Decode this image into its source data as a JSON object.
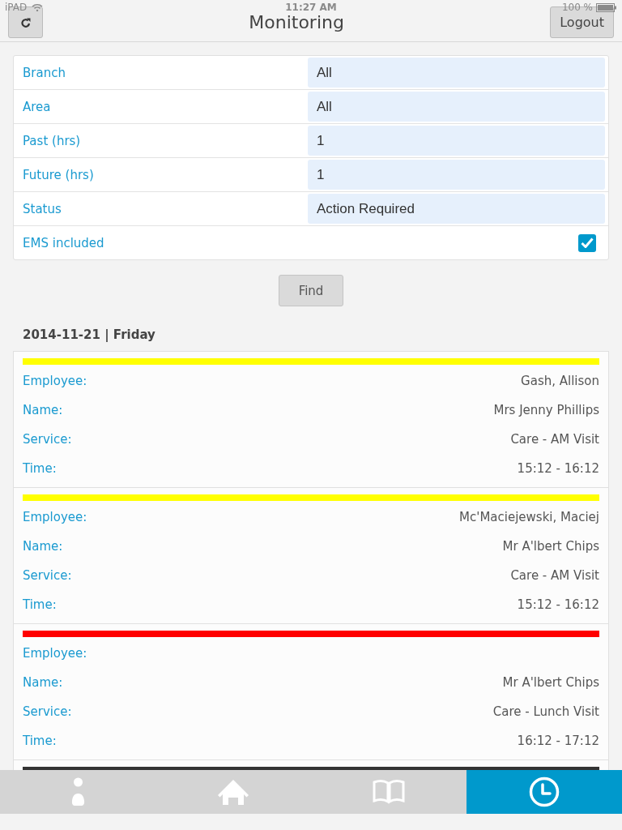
{
  "status_bar": {
    "carrier": "iPAD",
    "time": "11:27 AM",
    "battery": "100 %"
  },
  "header": {
    "title": "Monitoring",
    "logout": "Logout"
  },
  "filters": [
    {
      "kind": "select",
      "label": "Branch",
      "value": "All"
    },
    {
      "kind": "select",
      "label": "Area",
      "value": "All"
    },
    {
      "kind": "number",
      "label": "Past (hrs)",
      "value": "1"
    },
    {
      "kind": "number",
      "label": "Future (hrs)",
      "value": "1"
    },
    {
      "kind": "select",
      "label": "Status",
      "value": "Action Required"
    },
    {
      "kind": "checkbox",
      "label": "EMS included",
      "checked": true
    }
  ],
  "find_button": "Find",
  "date_heading": "2014-11-21 | Friday",
  "visits": [
    {
      "color": "#ffff00",
      "fields": [
        {
          "label": "Employee:",
          "value": "Gash, Allison"
        },
        {
          "label": "Name:",
          "value": "Mrs Jenny Phillips"
        },
        {
          "label": "Service:",
          "value": "Care - AM Visit"
        },
        {
          "label": "Time:",
          "value": "15:12 - 16:12"
        }
      ]
    },
    {
      "color": "#ffff00",
      "fields": [
        {
          "label": "Employee:",
          "value": "Mc'Maciejewski, Maciej"
        },
        {
          "label": "Name:",
          "value": "Mr A'lbert Chips"
        },
        {
          "label": "Service:",
          "value": "Care - AM Visit"
        },
        {
          "label": "Time:",
          "value": "15:12 - 16:12"
        }
      ]
    },
    {
      "color": "#ff0000",
      "fields": [
        {
          "label": "Employee:"
        },
        {
          "label": "Name:",
          "value": "Mr A'lbert Chips"
        },
        {
          "label": "Service:",
          "value": "Care - Lunch Visit"
        },
        {
          "label": "Time:",
          "value": "16:12 - 17:12"
        }
      ]
    },
    {
      "color": "#333333"
    }
  ],
  "tabs": [
    {
      "kind": "person",
      "selected": false
    },
    {
      "kind": "home",
      "selected": false
    },
    {
      "kind": "book",
      "selected": false
    },
    {
      "kind": "clock",
      "selected": true
    }
  ]
}
